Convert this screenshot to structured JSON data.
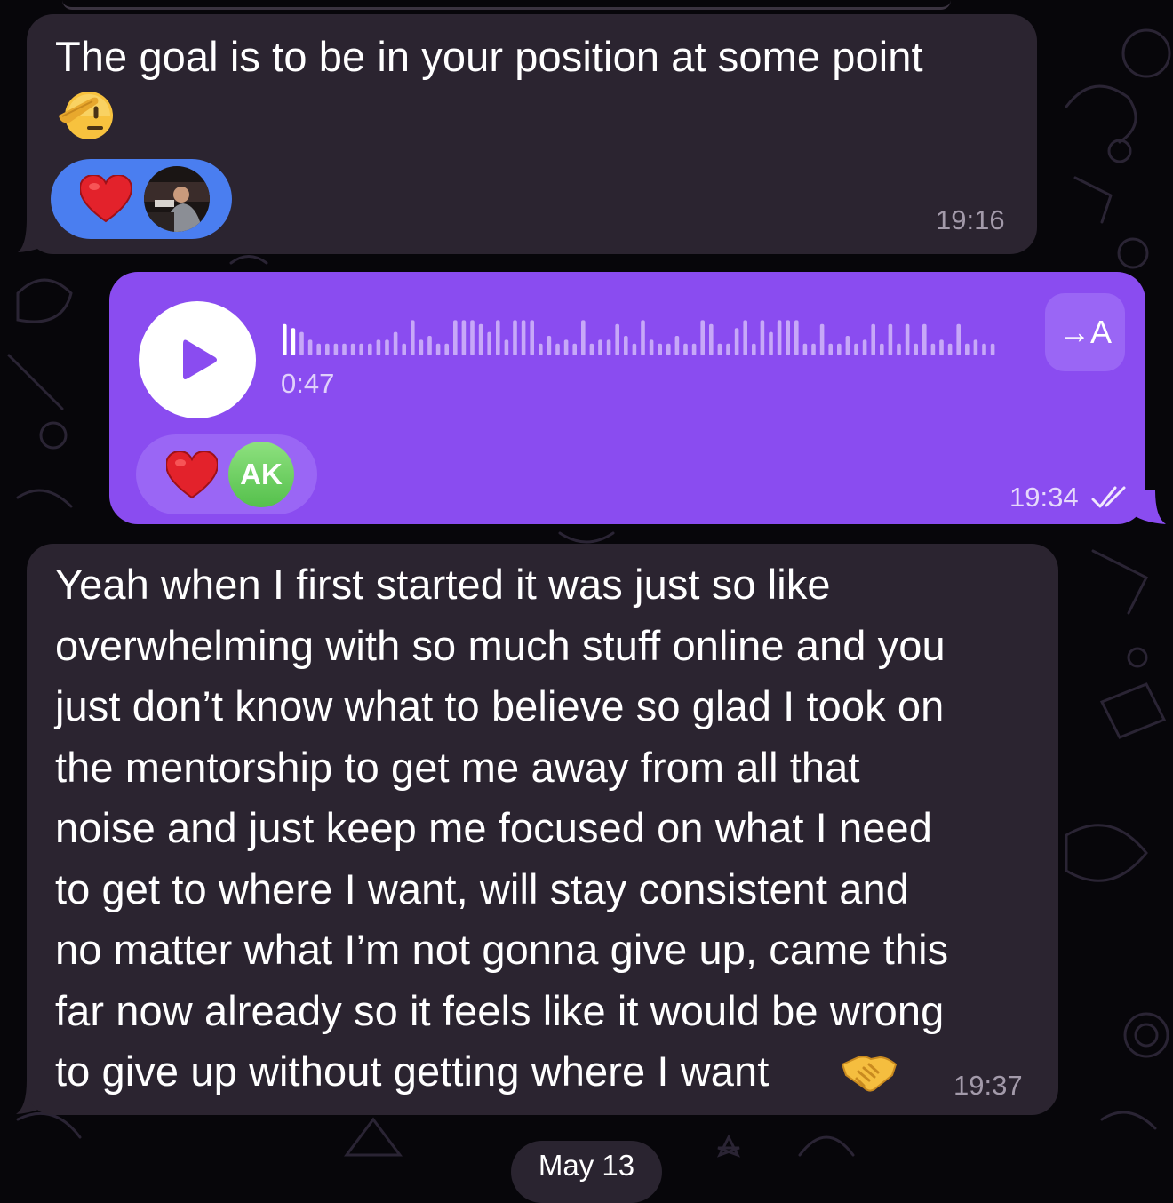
{
  "messages": [
    {
      "direction": "incoming",
      "text": "The goal is to be in your position at some point",
      "emoji": "saluting-face",
      "time": "19:16",
      "reactions": {
        "emoji": "heart",
        "reactor": "photo"
      }
    },
    {
      "direction": "outgoing",
      "type": "voice",
      "duration": "0:47",
      "transcribe_label": "→A",
      "time": "19:34",
      "status": "read",
      "reactions": {
        "emoji": "heart",
        "reactor_initials": "AK"
      }
    },
    {
      "direction": "incoming",
      "text": "Yeah when I first started it was just so like\noverwhelming with so much stuff online and you\njust don’t know what to believe so glad I took on\nthe mentorship to get me away from all that\nnoise and just keep me focused on what I need\nto get to where I want, will stay consistent and\nno matter what I’m not gonna give up, came this\nfar now already so it feels like it would be wrong\nto give up without getting where I want",
      "emoji": "handshake",
      "time": "19:37"
    }
  ],
  "date_separator": "May 13",
  "colors": {
    "background": "#07060a",
    "incoming_bubble": "#2b2430",
    "outgoing_bubble": "#8a4cf0",
    "reaction_blue": "#4a7ef0",
    "reaction_purple": "#9a66f5",
    "heart": "#e3222b",
    "avatar_green": "#55c04c"
  },
  "icons": [
    "play-icon",
    "check-icon",
    "heart-icon",
    "saluting-face-emoji",
    "handshake-emoji"
  ]
}
